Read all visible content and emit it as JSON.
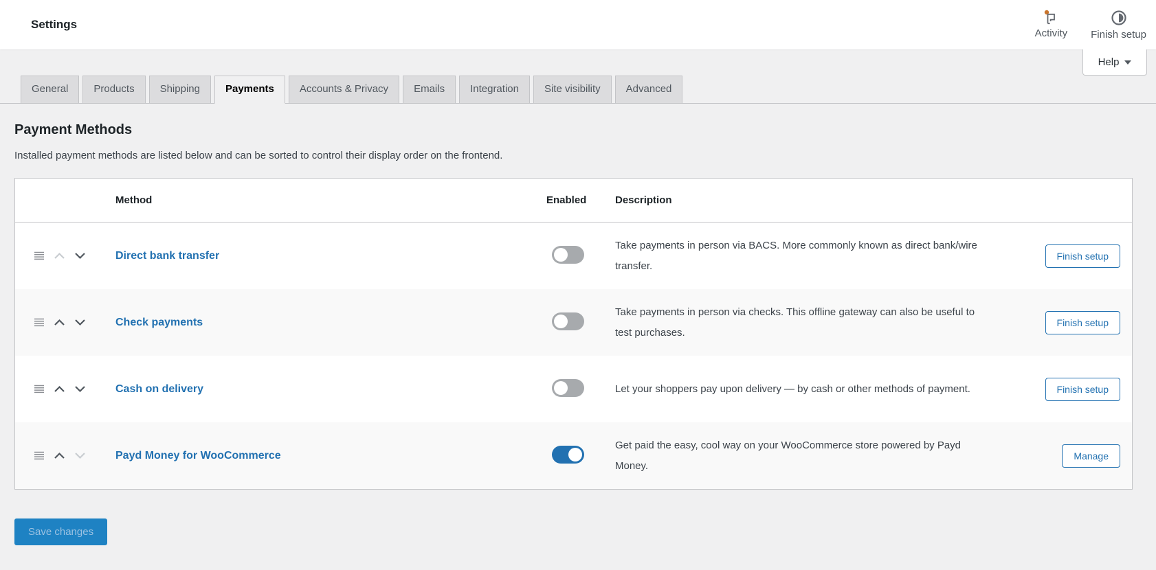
{
  "header": {
    "title": "Settings",
    "activity_label": "Activity",
    "finish_setup_label": "Finish setup",
    "help_label": "Help"
  },
  "icons": {
    "activity": "flag-with-notification-dot",
    "finish_setup": "half-filled-circle-progress",
    "help_caret": "chevron-down-triangle",
    "drag_handle": "hamburger-lines",
    "move_up": "chevron-up",
    "move_down": "chevron-down"
  },
  "tabs": [
    {
      "label": "General",
      "active": false
    },
    {
      "label": "Products",
      "active": false
    },
    {
      "label": "Shipping",
      "active": false
    },
    {
      "label": "Payments",
      "active": true
    },
    {
      "label": "Accounts & Privacy",
      "active": false
    },
    {
      "label": "Emails",
      "active": false
    },
    {
      "label": "Integration",
      "active": false
    },
    {
      "label": "Site visibility",
      "active": false
    },
    {
      "label": "Advanced",
      "active": false
    }
  ],
  "page": {
    "heading": "Payment Methods",
    "description": "Installed payment methods are listed below and can be sorted to control their display order on the frontend."
  },
  "table": {
    "columns": {
      "method": "Method",
      "enabled": "Enabled",
      "description": "Description"
    },
    "rows": [
      {
        "method": "Direct bank transfer",
        "enabled": false,
        "description": "Take payments in person via BACS. More commonly known as direct bank/wire transfer.",
        "action": "Finish setup",
        "up_disabled": true,
        "down_disabled": false
      },
      {
        "method": "Check payments",
        "enabled": false,
        "description": "Take payments in person via checks. This offline gateway can also be useful to test purchases.",
        "action": "Finish setup",
        "up_disabled": false,
        "down_disabled": false
      },
      {
        "method": "Cash on delivery",
        "enabled": false,
        "description": "Let your shoppers pay upon delivery — by cash or other methods of payment.",
        "action": "Finish setup",
        "up_disabled": false,
        "down_disabled": false
      },
      {
        "method": "Payd Money for WooCommerce",
        "enabled": true,
        "description": "Get paid the easy, cool way on your WooCommerce store powered by Payd Money.",
        "action": "Manage",
        "up_disabled": false,
        "down_disabled": true
      }
    ]
  },
  "footer": {
    "save_label": "Save changes"
  },
  "colors": {
    "accent": "#2271b1",
    "toggle_off": "#a7aaad",
    "notification_dot": "#c9742c",
    "save_bg": "#1e82c3",
    "save_text": "#9cc2e2"
  }
}
